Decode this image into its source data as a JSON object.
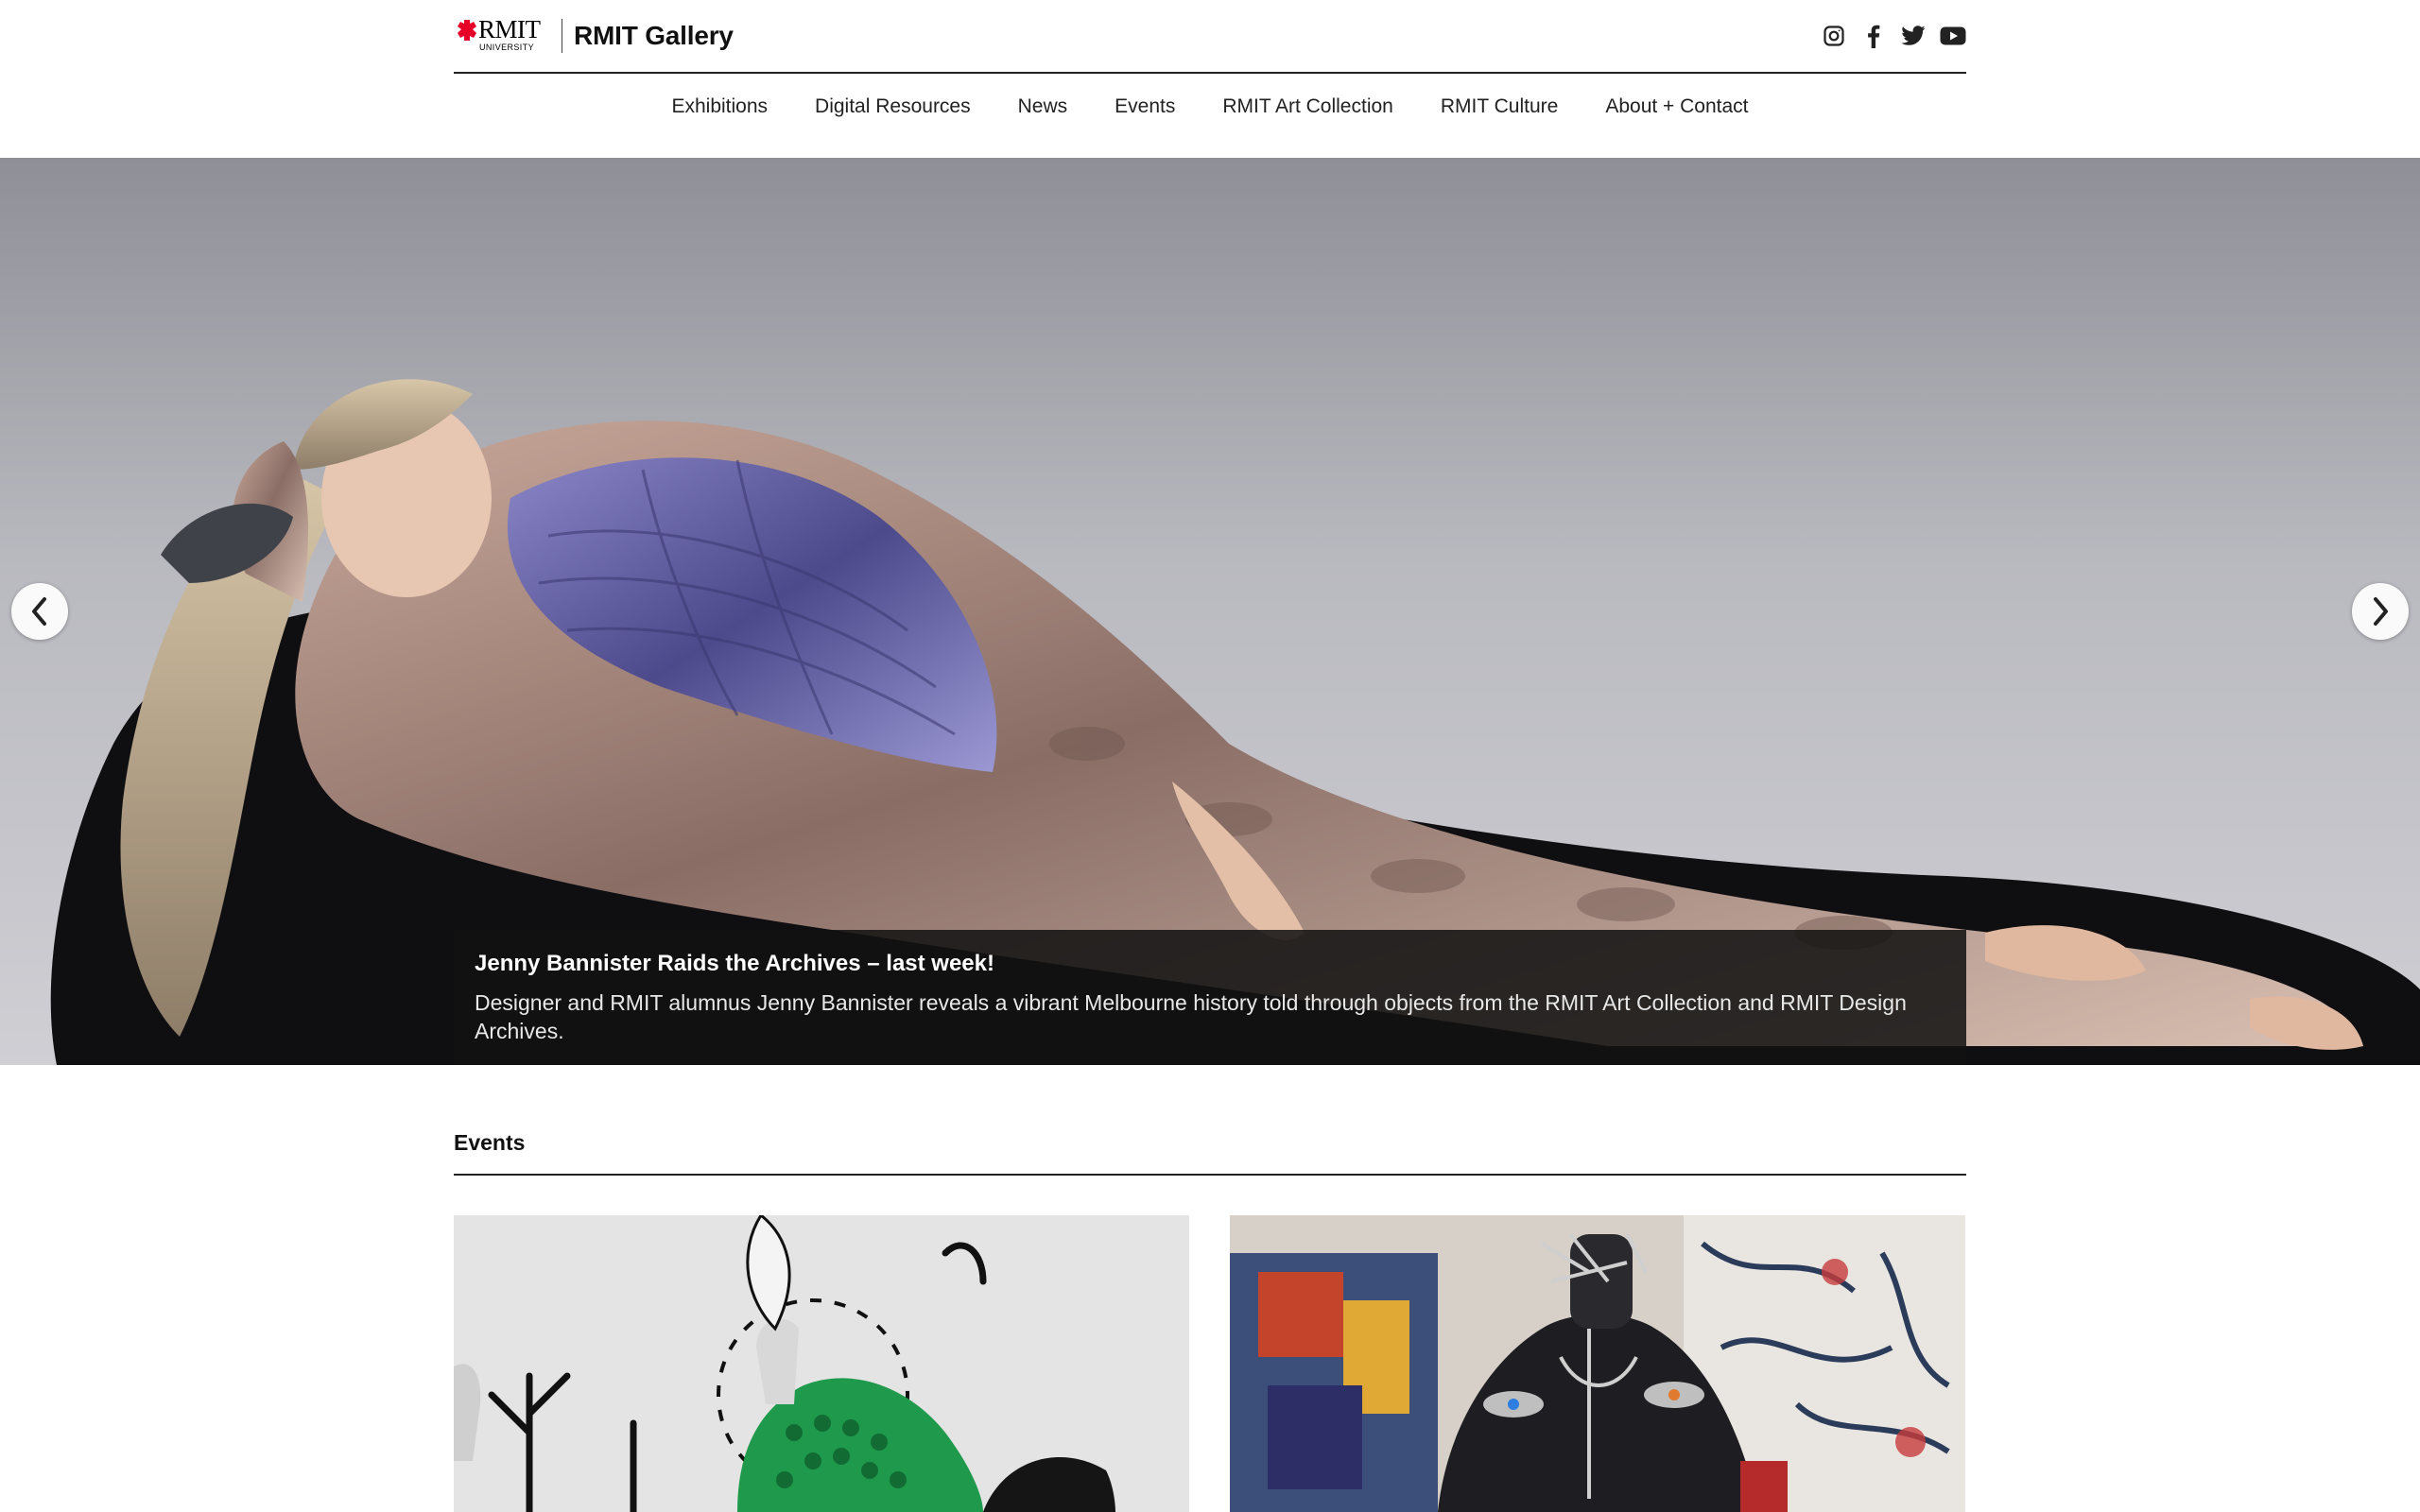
{
  "brand": {
    "logo_word": "RMIT",
    "logo_sub": "UNIVERSITY",
    "title": "RMIT Gallery",
    "accent": "#e60028"
  },
  "social": [
    {
      "icon": "instagram-icon"
    },
    {
      "icon": "facebook-icon"
    },
    {
      "icon": "twitter-icon"
    },
    {
      "icon": "youtube-icon"
    }
  ],
  "nav": {
    "items": [
      {
        "label": "Exhibitions"
      },
      {
        "label": "Digital Resources"
      },
      {
        "label": "News"
      },
      {
        "label": "Events"
      },
      {
        "label": "RMIT Art Collection"
      },
      {
        "label": "RMIT Culture"
      },
      {
        "label": "About + Contact"
      }
    ]
  },
  "hero": {
    "title": "Jenny Bannister Raids the Archives – last week!",
    "text": "Designer and RMIT alumnus Jenny Bannister reveals a vibrant Melbourne history told through objects from the RMIT Art Collection and RMIT Design Archives.",
    "prev_icon": "chevron-left-icon",
    "next_icon": "chevron-right-icon"
  },
  "events": {
    "heading": "Events"
  }
}
